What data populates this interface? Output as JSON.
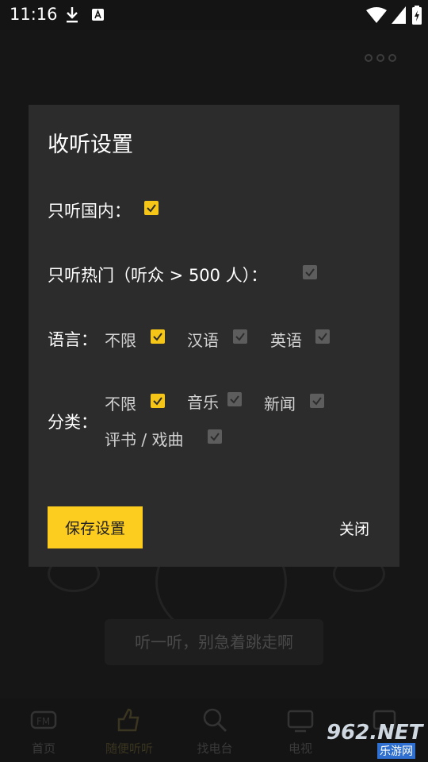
{
  "status_bar": {
    "time": "11:16"
  },
  "dialog": {
    "title": "收听设置",
    "domestic_only": {
      "label": "只听国内：",
      "checked": true
    },
    "popular_only": {
      "label": "只听热门（听众 > 500 人）：",
      "checked": false
    },
    "language": {
      "label": "语言：",
      "options": [
        {
          "label": "不限",
          "checked": true
        },
        {
          "label": "汉语",
          "checked": false
        },
        {
          "label": "英语",
          "checked": false
        }
      ]
    },
    "category": {
      "label": "分类：",
      "options": [
        {
          "label": "不限",
          "checked": true
        },
        {
          "label": "音乐",
          "checked": false
        },
        {
          "label": "新闻",
          "checked": false
        },
        {
          "label": "评书 / 戏曲",
          "checked": false
        }
      ]
    },
    "save_label": "保存设置",
    "close_label": "关闭"
  },
  "background": {
    "tip": "听一听，别急着跳走啊",
    "tabs": [
      {
        "label": "首页",
        "icon": "fm-icon"
      },
      {
        "label": "随便听听",
        "icon": "thumb-icon",
        "active": true
      },
      {
        "label": "找电台",
        "icon": "search-icon"
      },
      {
        "label": "电视",
        "icon": "tv-icon"
      },
      {
        "label": "",
        "icon": "hello-icon"
      }
    ]
  },
  "watermark": {
    "text": "962.NET",
    "sub": "乐游网"
  },
  "colors": {
    "accent": "#fccc1e",
    "dialog_bg": "#2c2c2c",
    "checkbox_off": "#5d5d5d"
  }
}
